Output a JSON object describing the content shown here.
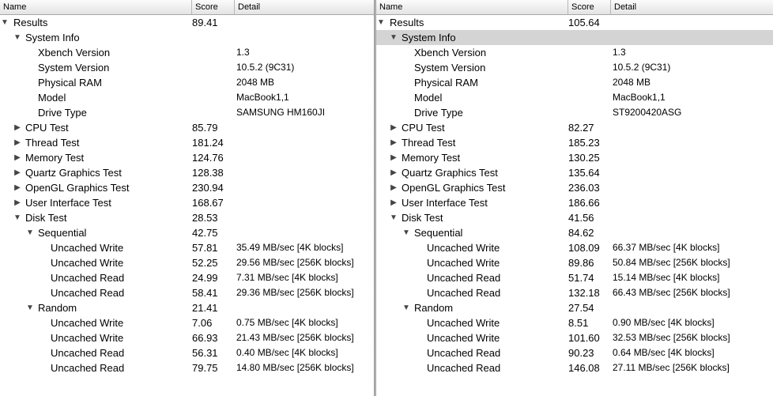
{
  "columns": {
    "name": "Name",
    "score": "Score",
    "detail": "Detail"
  },
  "panes": [
    {
      "rows": [
        {
          "level": 0,
          "disc": "open",
          "name": "Results",
          "score": "89.41",
          "detail": ""
        },
        {
          "level": 1,
          "disc": "open",
          "name": "System Info",
          "score": "",
          "detail": ""
        },
        {
          "level": 2,
          "disc": "none",
          "name": "Xbench Version",
          "score": "",
          "detail": "1.3"
        },
        {
          "level": 2,
          "disc": "none",
          "name": "System Version",
          "score": "",
          "detail": "10.5.2 (9C31)"
        },
        {
          "level": 2,
          "disc": "none",
          "name": "Physical RAM",
          "score": "",
          "detail": "2048 MB"
        },
        {
          "level": 2,
          "disc": "none",
          "name": "Model",
          "score": "",
          "detail": "MacBook1,1"
        },
        {
          "level": 2,
          "disc": "none",
          "name": "Drive Type",
          "score": "",
          "detail": "SAMSUNG HM160JI"
        },
        {
          "level": 1,
          "disc": "closed",
          "name": "CPU Test",
          "score": "85.79",
          "detail": ""
        },
        {
          "level": 1,
          "disc": "closed",
          "name": "Thread Test",
          "score": "181.24",
          "detail": ""
        },
        {
          "level": 1,
          "disc": "closed",
          "name": "Memory Test",
          "score": "124.76",
          "detail": ""
        },
        {
          "level": 1,
          "disc": "closed",
          "name": "Quartz Graphics Test",
          "score": "128.38",
          "detail": ""
        },
        {
          "level": 1,
          "disc": "closed",
          "name": "OpenGL Graphics Test",
          "score": "230.94",
          "detail": ""
        },
        {
          "level": 1,
          "disc": "closed",
          "name": "User Interface Test",
          "score": "168.67",
          "detail": ""
        },
        {
          "level": 1,
          "disc": "open",
          "name": "Disk Test",
          "score": "28.53",
          "detail": ""
        },
        {
          "level": 2,
          "disc": "open",
          "name": "Sequential",
          "score": "42.75",
          "detail": ""
        },
        {
          "level": 3,
          "disc": "none",
          "name": "Uncached Write",
          "score": "57.81",
          "detail": "35.49 MB/sec [4K blocks]"
        },
        {
          "level": 3,
          "disc": "none",
          "name": "Uncached Write",
          "score": "52.25",
          "detail": "29.56 MB/sec [256K blocks]"
        },
        {
          "level": 3,
          "disc": "none",
          "name": "Uncached Read",
          "score": "24.99",
          "detail": "7.31 MB/sec [4K blocks]"
        },
        {
          "level": 3,
          "disc": "none",
          "name": "Uncached Read",
          "score": "58.41",
          "detail": "29.36 MB/sec [256K blocks]"
        },
        {
          "level": 2,
          "disc": "open",
          "name": "Random",
          "score": "21.41",
          "detail": ""
        },
        {
          "level": 3,
          "disc": "none",
          "name": "Uncached Write",
          "score": "7.06",
          "detail": "0.75 MB/sec [4K blocks]"
        },
        {
          "level": 3,
          "disc": "none",
          "name": "Uncached Write",
          "score": "66.93",
          "detail": "21.43 MB/sec [256K blocks]"
        },
        {
          "level": 3,
          "disc": "none",
          "name": "Uncached Read",
          "score": "56.31",
          "detail": "0.40 MB/sec [4K blocks]"
        },
        {
          "level": 3,
          "disc": "none",
          "name": "Uncached Read",
          "score": "79.75",
          "detail": "14.80 MB/sec [256K blocks]"
        }
      ]
    },
    {
      "rows": [
        {
          "level": 0,
          "disc": "open",
          "name": "Results",
          "score": "105.64",
          "detail": ""
        },
        {
          "level": 1,
          "disc": "open",
          "name": "System Info",
          "score": "",
          "detail": "",
          "selected": true
        },
        {
          "level": 2,
          "disc": "none",
          "name": "Xbench Version",
          "score": "",
          "detail": "1.3"
        },
        {
          "level": 2,
          "disc": "none",
          "name": "System Version",
          "score": "",
          "detail": "10.5.2 (9C31)"
        },
        {
          "level": 2,
          "disc": "none",
          "name": "Physical RAM",
          "score": "",
          "detail": "2048 MB"
        },
        {
          "level": 2,
          "disc": "none",
          "name": "Model",
          "score": "",
          "detail": "MacBook1,1"
        },
        {
          "level": 2,
          "disc": "none",
          "name": "Drive Type",
          "score": "",
          "detail": "ST9200420ASG"
        },
        {
          "level": 1,
          "disc": "closed",
          "name": "CPU Test",
          "score": "82.27",
          "detail": ""
        },
        {
          "level": 1,
          "disc": "closed",
          "name": "Thread Test",
          "score": "185.23",
          "detail": ""
        },
        {
          "level": 1,
          "disc": "closed",
          "name": "Memory Test",
          "score": "130.25",
          "detail": ""
        },
        {
          "level": 1,
          "disc": "closed",
          "name": "Quartz Graphics Test",
          "score": "135.64",
          "detail": ""
        },
        {
          "level": 1,
          "disc": "closed",
          "name": "OpenGL Graphics Test",
          "score": "236.03",
          "detail": ""
        },
        {
          "level": 1,
          "disc": "closed",
          "name": "User Interface Test",
          "score": "186.66",
          "detail": ""
        },
        {
          "level": 1,
          "disc": "open",
          "name": "Disk Test",
          "score": "41.56",
          "detail": ""
        },
        {
          "level": 2,
          "disc": "open",
          "name": "Sequential",
          "score": "84.62",
          "detail": ""
        },
        {
          "level": 3,
          "disc": "none",
          "name": "Uncached Write",
          "score": "108.09",
          "detail": "66.37 MB/sec [4K blocks]"
        },
        {
          "level": 3,
          "disc": "none",
          "name": "Uncached Write",
          "score": "89.86",
          "detail": "50.84 MB/sec [256K blocks]"
        },
        {
          "level": 3,
          "disc": "none",
          "name": "Uncached Read",
          "score": "51.74",
          "detail": "15.14 MB/sec [4K blocks]"
        },
        {
          "level": 3,
          "disc": "none",
          "name": "Uncached Read",
          "score": "132.18",
          "detail": "66.43 MB/sec [256K blocks]"
        },
        {
          "level": 2,
          "disc": "open",
          "name": "Random",
          "score": "27.54",
          "detail": ""
        },
        {
          "level": 3,
          "disc": "none",
          "name": "Uncached Write",
          "score": "8.51",
          "detail": "0.90 MB/sec [4K blocks]"
        },
        {
          "level": 3,
          "disc": "none",
          "name": "Uncached Write",
          "score": "101.60",
          "detail": "32.53 MB/sec [256K blocks]"
        },
        {
          "level": 3,
          "disc": "none",
          "name": "Uncached Read",
          "score": "90.23",
          "detail": "0.64 MB/sec [4K blocks]"
        },
        {
          "level": 3,
          "disc": "none",
          "name": "Uncached Read",
          "score": "146.08",
          "detail": "27.11 MB/sec [256K blocks]"
        }
      ]
    }
  ]
}
